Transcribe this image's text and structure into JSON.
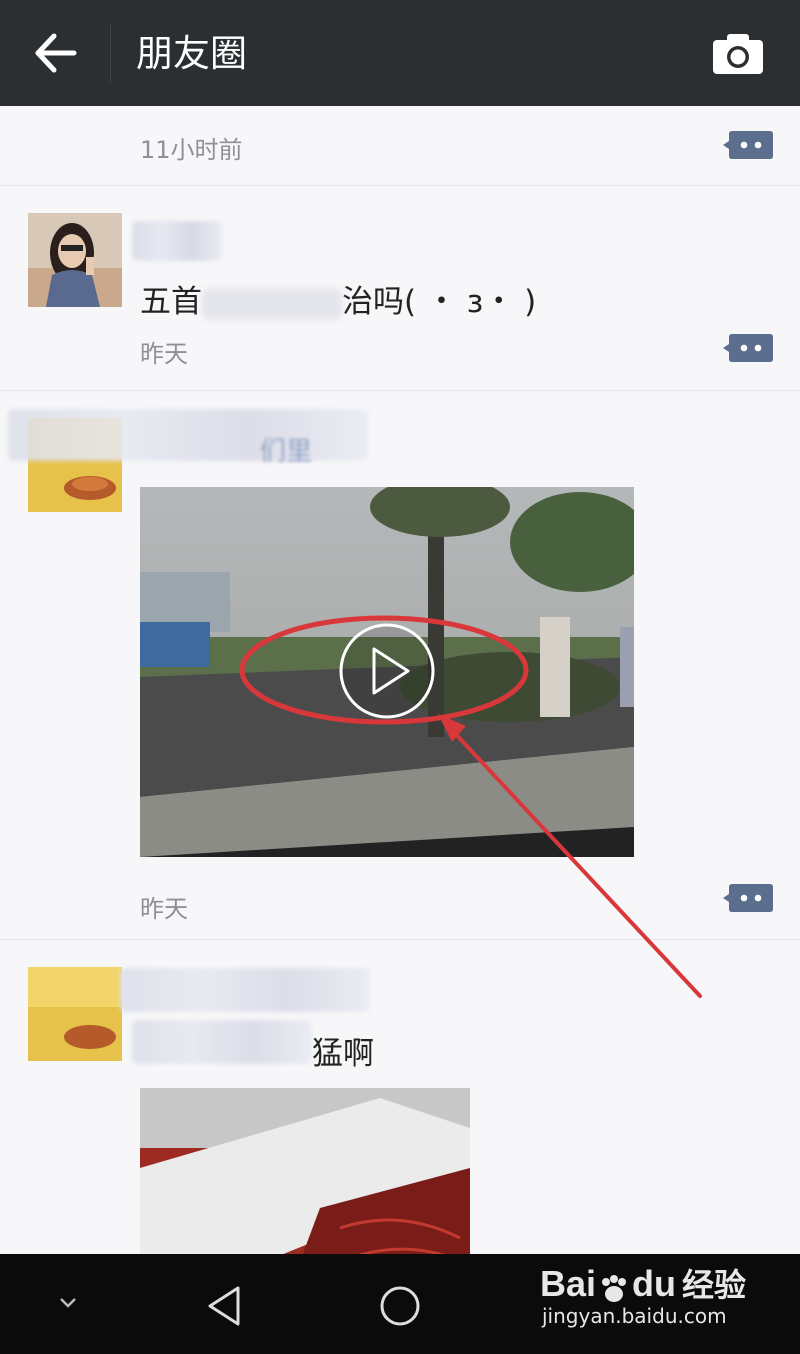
{
  "header": {
    "title": "朋友圈",
    "back_icon": "arrow-left-icon",
    "camera_icon": "camera-icon"
  },
  "posts": [
    {
      "time": "11小时前"
    },
    {
      "text_left": "五首",
      "text_right": "治吗( ・ з・ )",
      "time": "昨天"
    },
    {
      "text_suffix": "们里",
      "time": "昨天"
    },
    {
      "text_suffix": "猛啊"
    }
  ],
  "nav": {
    "collapse_icon": "chevron-down-icon",
    "back_icon": "triangle-back-icon",
    "home_icon": "circle-home-icon"
  },
  "watermark": {
    "brand": "Bai",
    "brand2": "du",
    "cn": "经验",
    "url": "jingyan.baidu.com"
  },
  "colors": {
    "annotation": "#d9383b",
    "topbar": "#2b2f32",
    "comment": "#5c6e8e"
  }
}
